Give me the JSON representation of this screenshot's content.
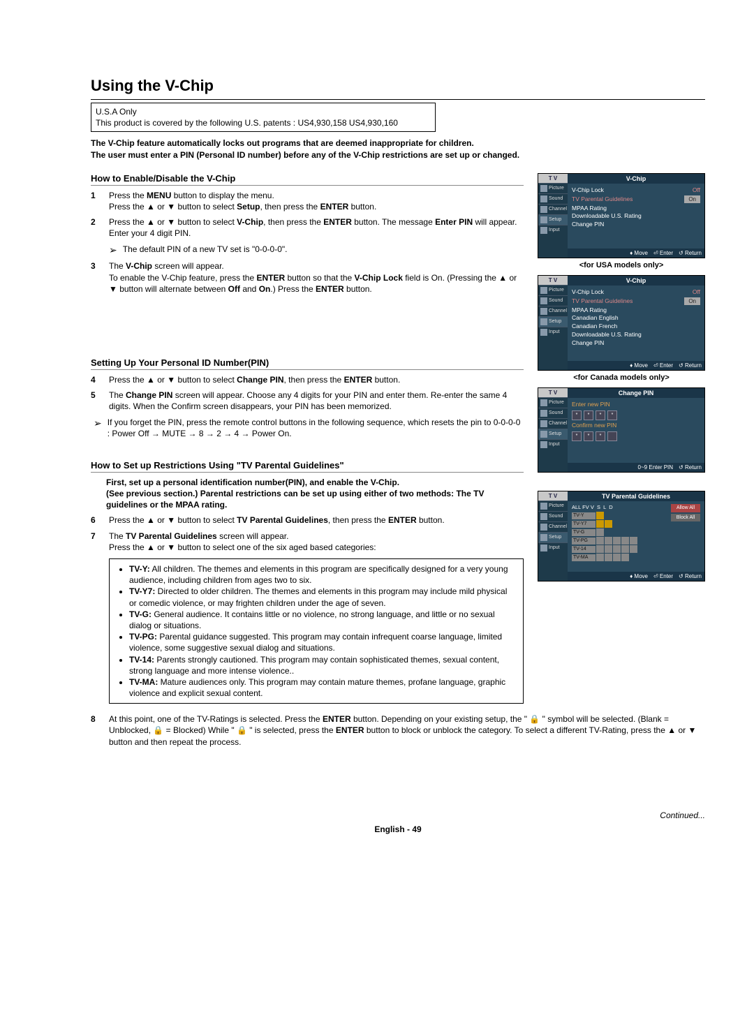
{
  "title": "Using the V-Chip",
  "patent": {
    "line1": "U.S.A Only",
    "line2": "This product is covered by the following U.S. patents : US4,930,158 US4,930,160"
  },
  "intro_l1": "The V-Chip feature automatically locks out programs that are deemed inappropriate for children.",
  "intro_l2": "The user must enter a PIN (Personal ID number) before any of the V-Chip restrictions are set up or changed.",
  "section1": {
    "heading": "How to Enable/Disable the V-Chip",
    "s1_num": "1",
    "s1_a": "Press the ",
    "s1_b": "MENU",
    "s1_c": " button to display the menu.",
    "s1_d": "Press the ▲ or ▼ button to select ",
    "s1_e": "Setup",
    "s1_f": ", then press the ",
    "s1_g": "ENTER",
    "s1_h": " button.",
    "s2_num": "2",
    "s2_a": "Press the ▲ or ▼ button to select ",
    "s2_b": "V-Chip",
    "s2_c": ", then press the ",
    "s2_d": "ENTER",
    "s2_e": " button. The message ",
    "s2_f": "Enter PIN",
    "s2_g": " will appear. Enter your 4 digit PIN.",
    "s2_note": "The default PIN of a new TV set is \"0-0-0-0\".",
    "s3_num": "3",
    "s3_a": "The ",
    "s3_b": "V-Chip",
    "s3_c": " screen will appear.",
    "s3_d": "To enable the V-Chip feature, press the ",
    "s3_e": "ENTER",
    "s3_f": " button so that the ",
    "s3_g": "V-Chip Lock",
    "s3_h": " field is On. (Pressing the ▲ or ▼ button will alternate between ",
    "s3_i": "Off",
    "s3_j": " and ",
    "s3_k": "On",
    "s3_l": ".) Press the ",
    "s3_m": "ENTER",
    "s3_n": " button."
  },
  "section2": {
    "heading": "Setting Up Your Personal ID Number(PIN)",
    "s4_num": "4",
    "s4_a": "Press the ▲ or ▼ button to select ",
    "s4_b": "Change PIN",
    "s4_c": ", then press the ",
    "s4_d": "ENTER",
    "s4_e": " button.",
    "s5_num": "5",
    "s5_a": "The ",
    "s5_b": "Change PIN",
    "s5_c": " screen will appear. Choose any 4 digits for your PIN and enter them. Re-enter the same 4 digits. When the Confirm screen disappears, your PIN has been memorized.",
    "note_a": "If you forget the PIN, press the remote control buttons in the following sequence, which resets the pin to 0-0-0-0 : Power Off → MUTE → 8 → 2 → 4 → Power On."
  },
  "section3": {
    "heading": "How to Set up Restrictions Using \"TV Parental Guidelines\"",
    "lead1": "First, set up a personal identification number(PIN), and enable the V-Chip.",
    "lead2": "(See previous section.) Parental restrictions can be set up using either of two methods: The TV guidelines or the MPAA rating.",
    "s6_num": "6",
    "s6_a": "Press the ▲ or ▼ button to select ",
    "s6_b": "TV Parental Guidelines",
    "s6_c": ", then press the ",
    "s6_d": "ENTER",
    "s6_e": " button.",
    "s7_num": "7",
    "s7_a": "The ",
    "s7_b": "TV Parental Guidelines",
    "s7_c": " screen will appear.",
    "s7_d": "Press the ▲ or ▼ button to select one of the six aged based categories:",
    "cats": {
      "y_l": "TV-Y:",
      "y_t": " All children. The themes and elements in this program are specifically designed for a very young audience, including children from ages two to six.",
      "y7_l": "TV-Y7:",
      "y7_t": " Directed to older children. The themes and elements in this program may include mild physical or comedic violence, or may frighten children under the age of seven.",
      "g_l": "TV-G:",
      "g_t": " General audience. It contains little or no violence, no strong language, and little or no sexual dialog or situations.",
      "pg_l": "TV-PG:",
      "pg_t": " Parental guidance suggested. This program may contain infrequent coarse language, limited violence, some suggestive sexual dialog and situations.",
      "t14_l": "TV-14:",
      "t14_t": " Parents strongly cautioned. This program may contain sophisticated themes, sexual content, strong language and more intense violence..",
      "ma_l": "TV-MA:",
      "ma_t": " Mature audiences only. This program may contain mature themes, profane language, graphic violence and explicit sexual content."
    },
    "s8_num": "8",
    "s8_a": "At this point, one of the TV-Ratings is selected. Press the ",
    "s8_b": "ENTER",
    "s8_c": " button. Depending on your existing setup, the \" 🔒 \" symbol will be selected. (Blank = Unblocked, 🔒 = Blocked) While \" 🔒 \" is selected, press the ",
    "s8_d": "ENTER",
    "s8_e": " button to block or unblock the category. To select a different TV-Rating, press the ▲ or ▼ button and then repeat the process."
  },
  "osd": {
    "tv": "T V",
    "side": {
      "picture": "Picture",
      "sound": "Sound",
      "channel": "Channel",
      "setup": "Setup",
      "input": "Input"
    },
    "vchip": {
      "title": "V-Chip",
      "lock": "V-Chip Lock",
      "off": "Off",
      "tvpg": "TV Parental Guidelines",
      "on": "On",
      "mpaa": "MPAA Rating",
      "ce": "Canadian English",
      "cf": "Canadian French",
      "dl": "Downloadable U.S. Rating",
      "cp": "Change PIN",
      "move": "Move",
      "enter": "Enter",
      "return": "Return"
    },
    "cap_usa": "<for USA models only>",
    "cap_can": "<for Canada models only>",
    "change": {
      "title": "Change PIN",
      "enter_new": "Enter new PIN",
      "confirm": "Confirm new PIN",
      "foot_enter": "Enter PIN",
      "foot_return": "Return",
      "zeros": "0~9"
    },
    "tvpg_screen": {
      "title": "TV Parental Guidelines",
      "cols": "ALL FV V  S  L  D",
      "allow": "Allow All",
      "block": "Block All",
      "r1": "TV-Y",
      "r2": "TV-Y7",
      "r3": "TV-G",
      "r4": "TV-PG",
      "r5": "TV-14",
      "r6": "TV-MA"
    }
  },
  "continued": "Continued...",
  "footer": "English - 49"
}
